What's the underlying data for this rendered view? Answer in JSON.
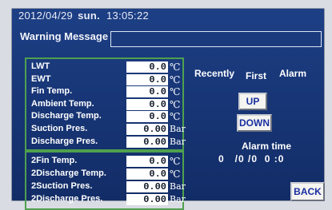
{
  "header": {
    "date": "2012/04/29",
    "day": "sun.",
    "time": "13:05:22"
  },
  "warning": {
    "label": "Warning Message",
    "value": ""
  },
  "group1": [
    {
      "label": "LWT",
      "value": "0.0",
      "unit": "℃"
    },
    {
      "label": "EWT",
      "value": "0.0",
      "unit": "℃"
    },
    {
      "label": "Fin Temp.",
      "value": "0.0",
      "unit": "℃"
    },
    {
      "label": "Ambient Temp.",
      "value": "0.0",
      "unit": "℃"
    },
    {
      "label": "Discharge Temp.",
      "value": "0.0",
      "unit": "℃"
    },
    {
      "label": "Suction Pres.",
      "value": "0.00",
      "unit": "Bar"
    },
    {
      "label": "Discharge Pres.",
      "value": "0.00",
      "unit": "Bar"
    }
  ],
  "group2": [
    {
      "label": "2Fin Temp.",
      "value": "0.0",
      "unit": "℃"
    },
    {
      "label": "2Discharge Temp.",
      "value": "0.0",
      "unit": "℃"
    },
    {
      "label": "2Suction Pres.",
      "value": "0.00",
      "unit": "Bar"
    },
    {
      "label": "2Discharge Pres.",
      "value": "0.00",
      "unit": "Bar"
    }
  ],
  "alarm": {
    "recently": "Recently",
    "first": "First",
    "alarm_label": "Alarm",
    "up": "UP",
    "down": "DOWN",
    "time_label": "Alarm time",
    "time_value": "0   /0 /0  0 :0"
  },
  "back": "BACK",
  "colors": {
    "screen": "#16326e",
    "panel_border": "#4fa04e",
    "button_text": "#1a2fa0"
  }
}
